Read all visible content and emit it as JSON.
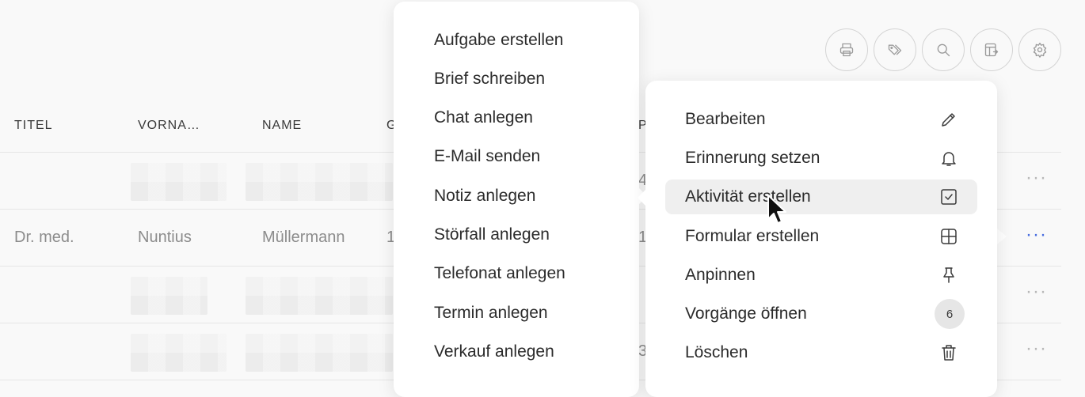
{
  "toolbar": {
    "buttons": [
      {
        "icon": "printer-icon"
      },
      {
        "icon": "tags-icon"
      },
      {
        "icon": "search-icon"
      },
      {
        "icon": "table-export-icon"
      },
      {
        "icon": "gear-icon"
      }
    ]
  },
  "table": {
    "headers": [
      "TITEL",
      "VORNA…",
      "NAME",
      "G",
      "P"
    ],
    "rows": [
      {
        "titel": "",
        "vorname": "",
        "name": "",
        "g": "",
        "p": "4"
      },
      {
        "titel": "Dr. med.",
        "vorname": "Nuntius",
        "name": "Müllermann",
        "g": "1",
        "p": "1"
      },
      {
        "titel": "",
        "vorname": "",
        "name": "",
        "g": "",
        "p": ""
      },
      {
        "titel": "",
        "vorname": "",
        "name": "",
        "g": "",
        "p": "3"
      }
    ],
    "row_actions": "···"
  },
  "submenu": {
    "items": [
      "Aufgabe erstellen",
      "Brief schreiben",
      "Chat anlegen",
      "E-Mail senden",
      "Notiz anlegen",
      "Störfall anlegen",
      "Telefonat anlegen",
      "Termin anlegen",
      "Verkauf anlegen"
    ]
  },
  "mainmenu": {
    "items": [
      {
        "label": "Bearbeiten",
        "icon": "pencil-icon"
      },
      {
        "label": "Erinnerung setzen",
        "icon": "bell-icon"
      },
      {
        "label": "Aktivität erstellen",
        "icon": "checkbox-icon",
        "highlighted": true
      },
      {
        "label": "Formular erstellen",
        "icon": "grid-icon"
      },
      {
        "label": "Anpinnen",
        "icon": "pin-icon"
      },
      {
        "label": "Vorgänge öffnen",
        "badge": "6"
      },
      {
        "label": "Löschen",
        "icon": "trash-icon"
      }
    ]
  },
  "colors": {
    "accent": "#4a6ee0",
    "highlight": "#efefef"
  }
}
